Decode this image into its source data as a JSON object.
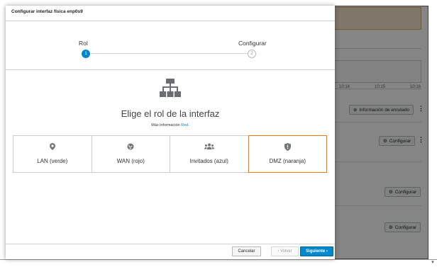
{
  "dialog": {
    "title": "Configurar interfaz física enp0s9"
  },
  "steps": [
    {
      "label": "Rol",
      "number": "1",
      "active": true
    },
    {
      "label": "Configurar",
      "number": "2",
      "active": false
    }
  ],
  "main": {
    "heading": "Elige el rol de la interfaz",
    "more_info_prefix": "Más información",
    "more_info_link": "Red."
  },
  "roles": [
    {
      "label": "LAN (verde)",
      "icon": "map-marker-icon",
      "selected": false
    },
    {
      "label": "WAN (rojo)",
      "icon": "globe-icon",
      "selected": false
    },
    {
      "label": "Invitados (azul)",
      "icon": "users-icon",
      "selected": false
    },
    {
      "label": "DMZ (naranja)",
      "icon": "shield-icon",
      "selected": true
    }
  ],
  "footer": {
    "cancel": "Cancelar",
    "back": "‹ Volver",
    "next": "Siguiente ›"
  },
  "background": {
    "times": [
      "10:14",
      "10:15",
      "10:16"
    ],
    "routing_info_button": "Información de enrutado",
    "configure_button": "Configurar"
  },
  "colors": {
    "primary": "#0088ce",
    "selected_border": "#ec7a08"
  }
}
